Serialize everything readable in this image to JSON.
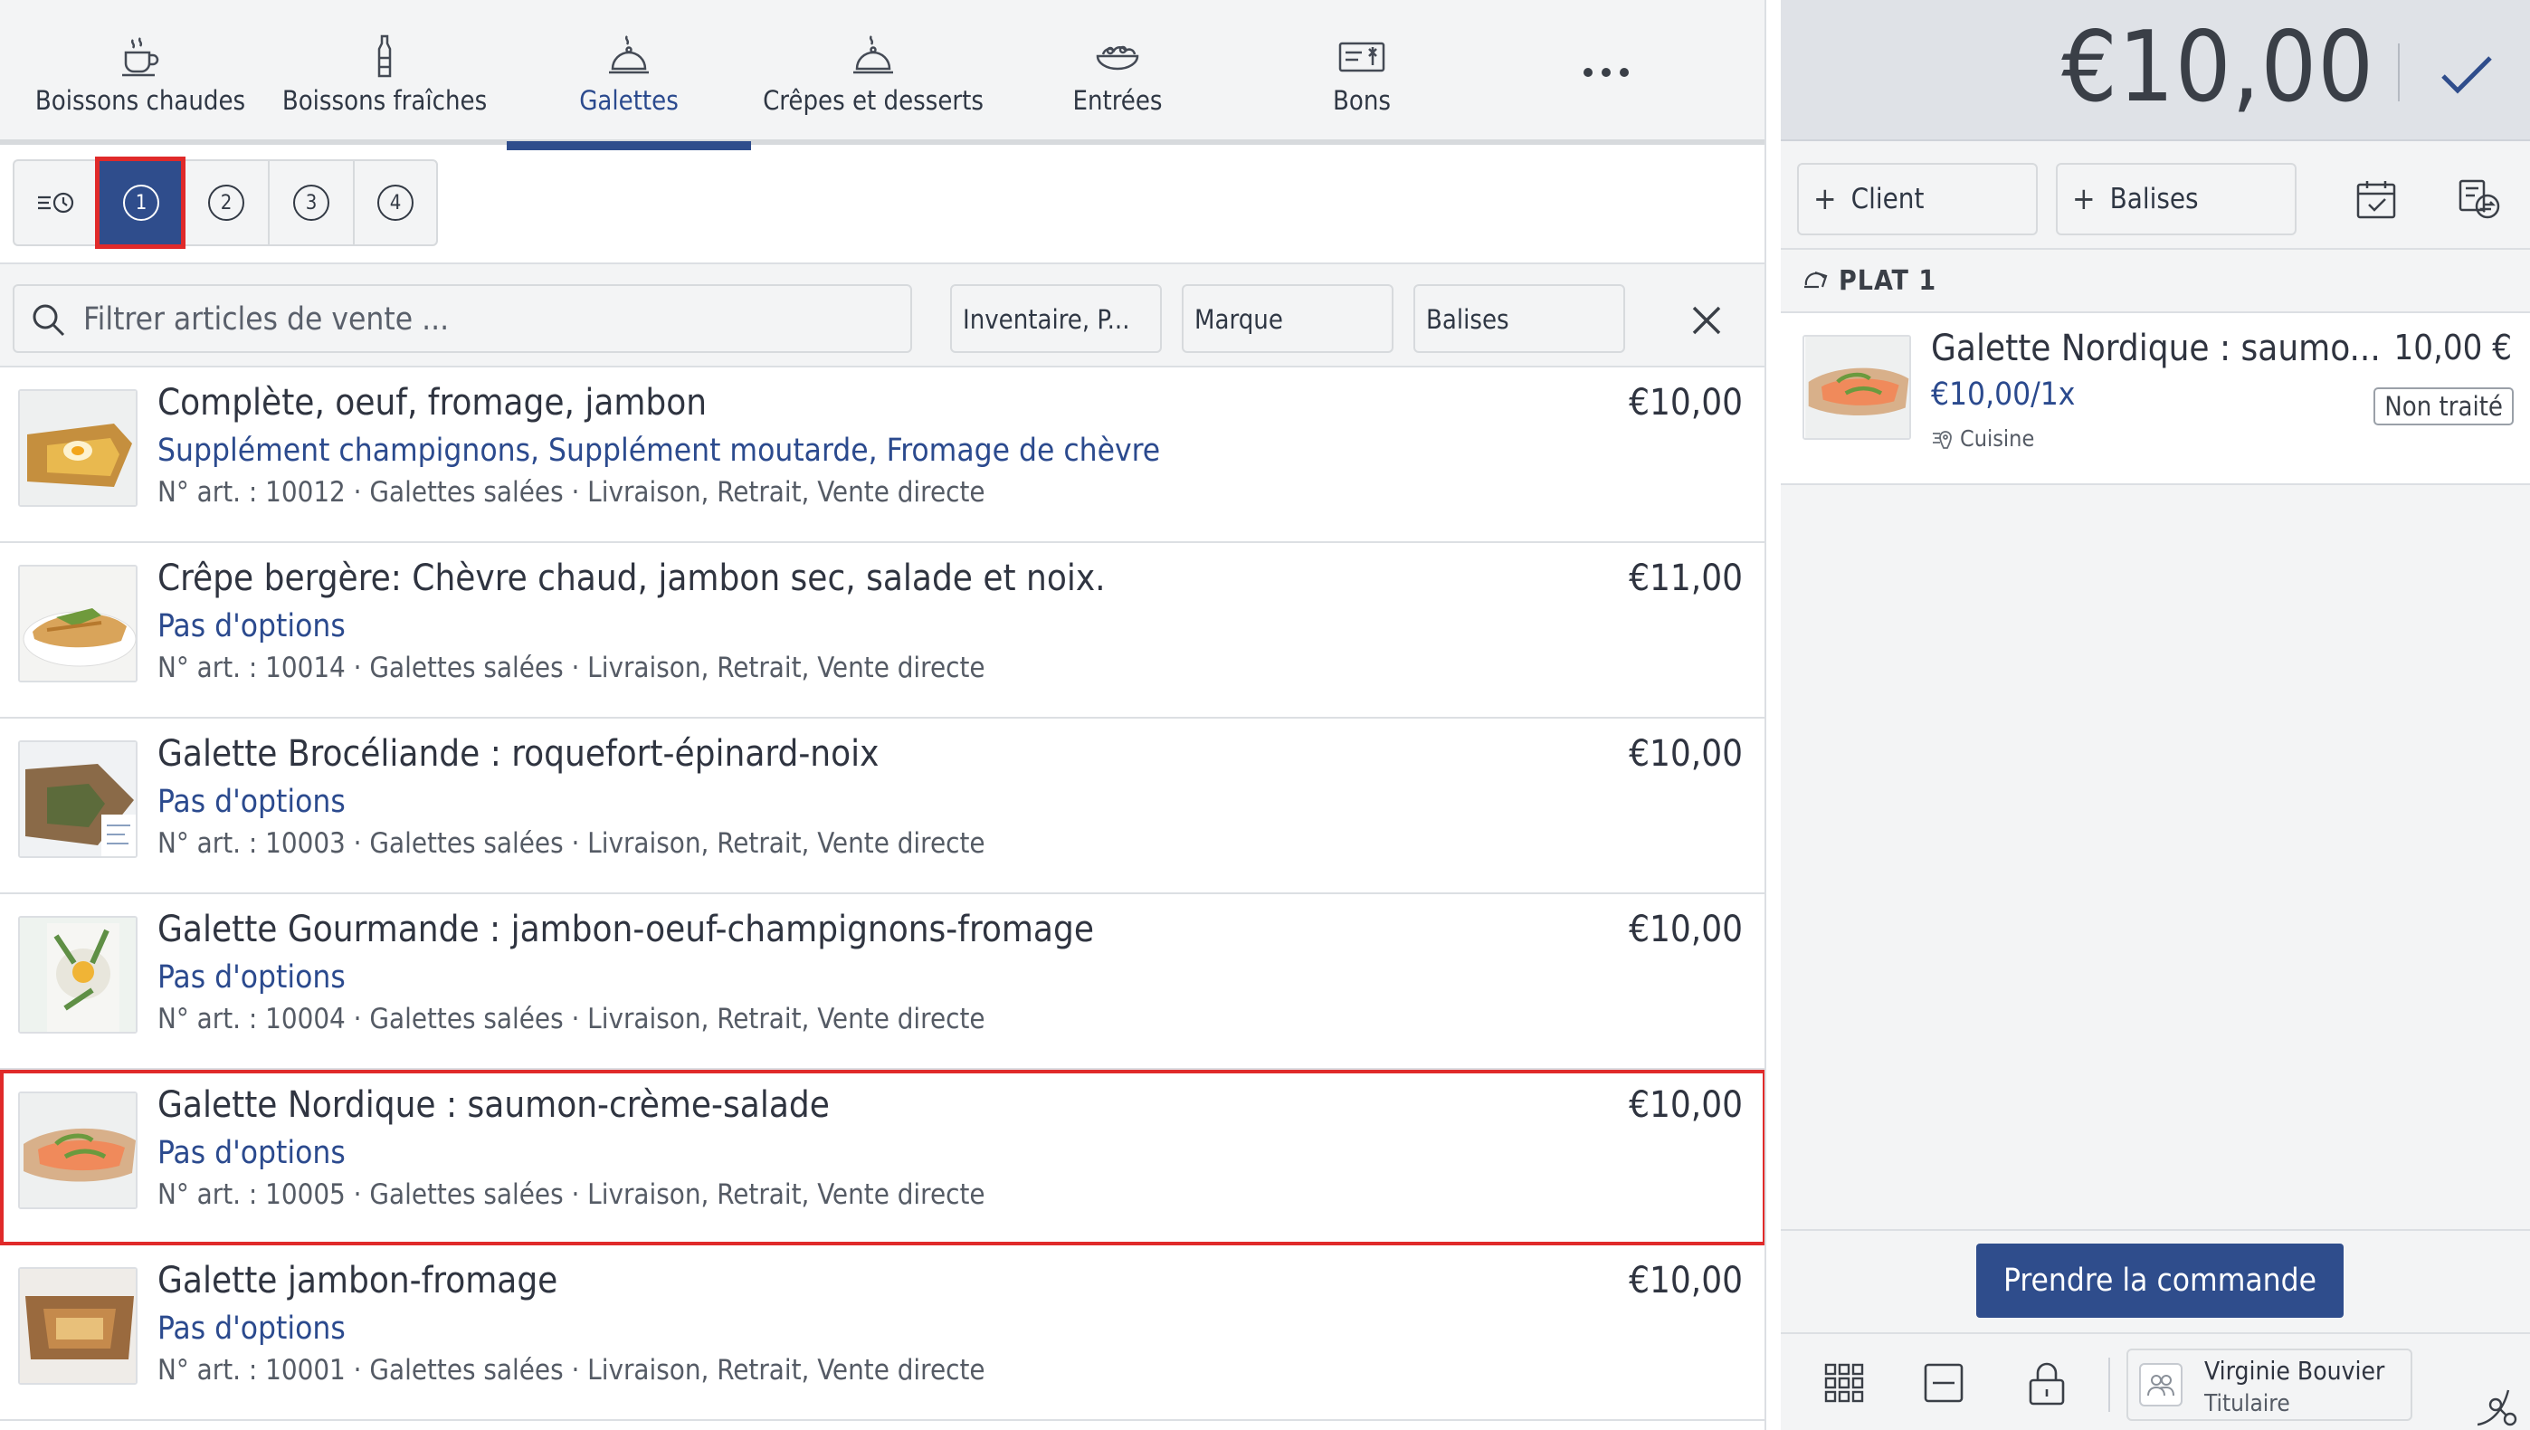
{
  "categories": [
    {
      "label": "Boissons chaudes",
      "icon": "hot-drink-icon",
      "active": false
    },
    {
      "label": "Boissons fraîches",
      "icon": "cold-drink-bottle-icon",
      "active": false
    },
    {
      "label": "Galettes",
      "icon": "cloche-icon",
      "active": true
    },
    {
      "label": "Crêpes et desserts",
      "icon": "cloche-icon",
      "active": false
    },
    {
      "label": "Entrées",
      "icon": "salad-bowl-icon",
      "active": false
    },
    {
      "label": "Bons",
      "icon": "voucher-icon",
      "active": false
    }
  ],
  "more_label": "•••",
  "courses": [
    "1",
    "2",
    "3",
    "4"
  ],
  "active_course": "1",
  "filters": {
    "search_placeholder": "Filtrer articles de vente ...",
    "inventory": "Inventaire, P...",
    "brand": "Marque",
    "tags": "Balises"
  },
  "items": [
    {
      "name": "Complète, oeuf, fromage, jambon",
      "options": "Supplément champignons, Supplément moutarde, Fromage de chèvre",
      "meta": "N° art. : 10012 · Galettes salées · Livraison, Retrait, Vente directe",
      "price": "€10,00",
      "selected": false
    },
    {
      "name": "Crêpe bergère: Chèvre chaud, jambon sec, salade et noix.",
      "options": "Pas d'options",
      "meta": "N° art. : 10014 · Galettes salées · Livraison, Retrait, Vente directe",
      "price": "€11,00",
      "selected": false
    },
    {
      "name": "Galette Brocéliande : roquefort-épinard-noix",
      "options": "Pas d'options",
      "meta": "N° art. : 10003 · Galettes salées · Livraison, Retrait, Vente directe",
      "price": "€10,00",
      "selected": false
    },
    {
      "name": "Galette Gourmande : jambon-oeuf-champignons-fromage",
      "options": "Pas d'options",
      "meta": "N° art. : 10004 · Galettes salées · Livraison, Retrait, Vente directe",
      "price": "€10,00",
      "selected": false
    },
    {
      "name": "Galette Nordique : saumon-crème-salade",
      "options": "Pas d'options",
      "meta": "N° art. : 10005 · Galettes salées · Livraison, Retrait, Vente directe",
      "price": "€10,00",
      "selected": true
    },
    {
      "name": "Galette jambon-fromage",
      "options": "Pas d'options",
      "meta": "N° art. : 10001 · Galettes salées · Livraison, Retrait, Vente directe",
      "price": "€10,00",
      "selected": false
    }
  ],
  "order": {
    "total": "€10,00",
    "client_label": "Client",
    "tags_label": "Balises",
    "course_heading": "PLAT 1",
    "line": {
      "name": "Galette Nordique : saumo...",
      "price": "10,00 €",
      "unit_price": "€10,00/1x",
      "station": "Cuisine",
      "status": "Non traité"
    },
    "place_order_label": "Prendre la commande"
  },
  "user": {
    "name": "Virginie Bouvier",
    "role": "Titulaire"
  },
  "colors": {
    "accent": "#2f4d8c",
    "highlight": "#e02a2a",
    "panel": "#f3f4f5",
    "total_bar": "#dfe2e7"
  }
}
